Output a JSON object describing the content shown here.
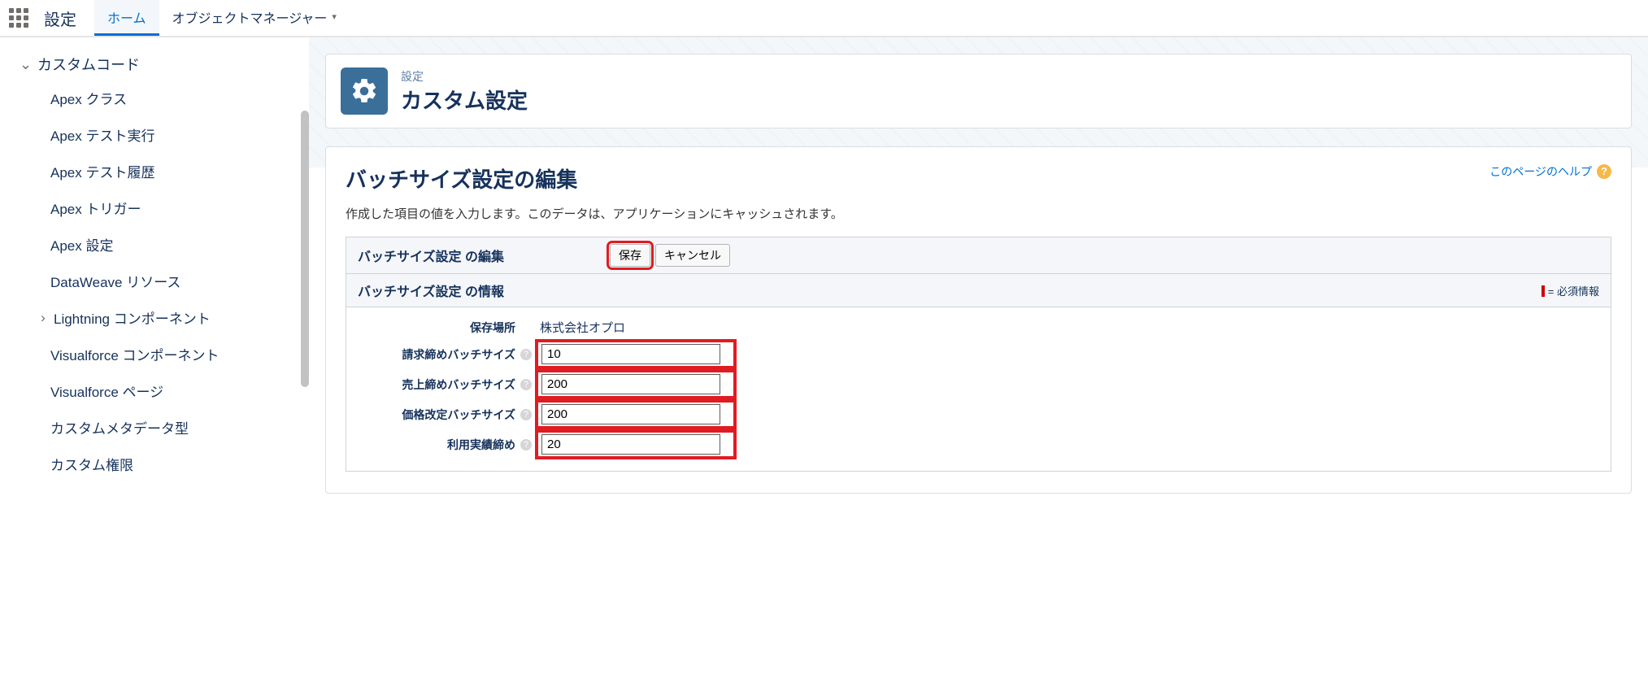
{
  "topbar": {
    "title": "設定",
    "tabs": [
      {
        "label": "ホーム",
        "active": true
      },
      {
        "label": "オブジェクトマネージャー",
        "active": false
      }
    ]
  },
  "sidebar": {
    "group_label": "カスタムコード",
    "items": [
      {
        "label": "Apex クラス"
      },
      {
        "label": "Apex テスト実行"
      },
      {
        "label": "Apex テスト履歴"
      },
      {
        "label": "Apex トリガー"
      },
      {
        "label": "Apex 設定"
      },
      {
        "label": "DataWeave リソース"
      },
      {
        "label": "Lightning コンポーネント",
        "group": true
      },
      {
        "label": "Visualforce コンポーネント"
      },
      {
        "label": "Visualforce ページ"
      },
      {
        "label": "カスタムメタデータ型"
      },
      {
        "label": "カスタム権限"
      }
    ]
  },
  "header": {
    "crumb": "設定",
    "title": "カスタム設定"
  },
  "page": {
    "subtitle": "バッチサイズ設定の編集",
    "help_link": "このページのヘルプ",
    "description": "作成した項目の値を入力します。このデータは、アプリケーションにキャッシュされます。"
  },
  "editbox": {
    "section_edit": "バッチサイズ設定 の編集",
    "save_label": "保存",
    "cancel_label": "キャンセル",
    "section_info": "バッチサイズ設定 の情報",
    "required_note": "= 必須情報"
  },
  "form": {
    "location_label": "保存場所",
    "location_value": "株式会社オプロ",
    "fields": [
      {
        "label": "請求締めバッチサイズ",
        "value": "10"
      },
      {
        "label": "売上締めバッチサイズ",
        "value": "200"
      },
      {
        "label": "価格改定バッチサイズ",
        "value": "200"
      },
      {
        "label": "利用実績締め",
        "value": "20"
      }
    ]
  }
}
